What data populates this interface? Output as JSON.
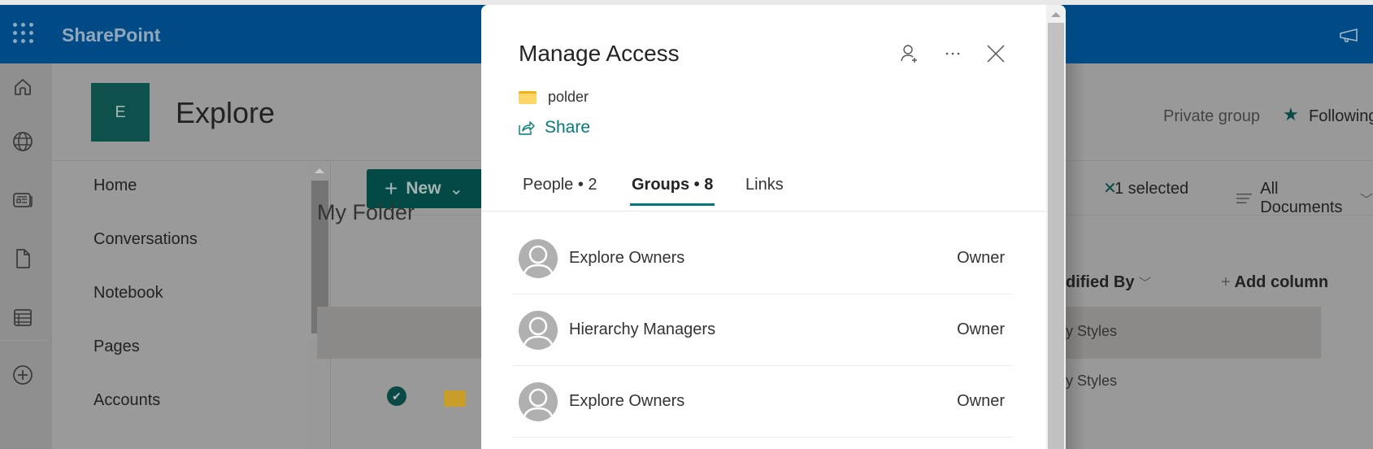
{
  "suitebar": {
    "app_name": "SharePoint",
    "waffle_icon": "app-launcher-icon",
    "feedback_icon": "megaphone-icon"
  },
  "appbar": {
    "items": [
      {
        "name": "home",
        "icon": "home-icon"
      },
      {
        "name": "sites",
        "icon": "globe-icon"
      },
      {
        "name": "news",
        "icon": "news-icon"
      },
      {
        "name": "files",
        "icon": "document-icon"
      },
      {
        "name": "lists",
        "icon": "list-icon"
      },
      {
        "name": "create",
        "icon": "add-circle-icon"
      }
    ]
  },
  "site": {
    "logo_letter": "E",
    "title": "Explore",
    "privacy": "Private group",
    "follow_label": "Following"
  },
  "leftnav": {
    "items": [
      "Home",
      "Conversations",
      "Notebook",
      "Pages",
      "Accounts"
    ]
  },
  "commandbar": {
    "new_label": "New",
    "selection_count": "1 selected",
    "view_label": "All Documents"
  },
  "library": {
    "folder_title": "My Folder",
    "columns": {
      "modified_by": "dified By",
      "add_column": "Add column"
    },
    "rows": [
      {
        "modified_by": "y Styles",
        "selected": true
      },
      {
        "modified_by": "y Styles",
        "selected": false
      }
    ]
  },
  "dialog": {
    "title": "Manage Access",
    "item_name": "polder",
    "share_label": "Share",
    "tabs": [
      {
        "label": "People • 2",
        "active": false
      },
      {
        "label": "Groups • 8",
        "active": true
      },
      {
        "label": "Links",
        "active": false
      }
    ],
    "groups": [
      {
        "name": "Explore Owners",
        "role": "Owner"
      },
      {
        "name": "Hierarchy Managers",
        "role": "Owner"
      },
      {
        "name": "Explore Owners",
        "role": "Owner"
      }
    ],
    "accent_color": "#03787c"
  }
}
